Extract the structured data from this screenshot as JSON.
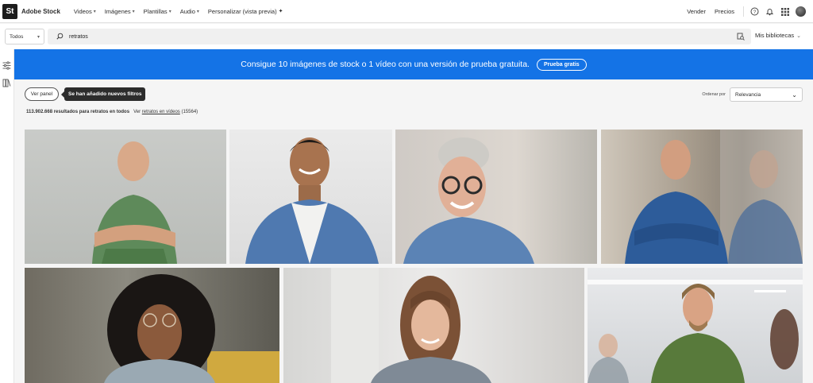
{
  "header": {
    "logo": "St",
    "brand": "Adobe Stock",
    "nav": [
      "Videos",
      "Imágenes",
      "Plantillas",
      "Audio"
    ],
    "personalize": "Personalizar (vista previa)",
    "sell": "Vender",
    "pricing": "Precios"
  },
  "search": {
    "type": "Todos",
    "query": "retratos",
    "libraries": "Mis bibliotecas"
  },
  "banner": {
    "text": "Consigue 10 imágenes de stock o 1 vídeo con una versión de prueba gratuita.",
    "button": "Prueba gratis"
  },
  "toolbar": {
    "view_panel": "Ver panel",
    "tooltip": "Se han añadido nuevos filtros",
    "results_count": "113.902.668 resultados para retratos en todos",
    "see_label": "Ver",
    "videos_link": "retratos en vídeos",
    "videos_count": "(15564)",
    "sort_label": "Ordenar por",
    "sort_value": "Relevancia"
  },
  "colors": {
    "accent": "#1473e6",
    "dark": "#2c2c2c"
  }
}
